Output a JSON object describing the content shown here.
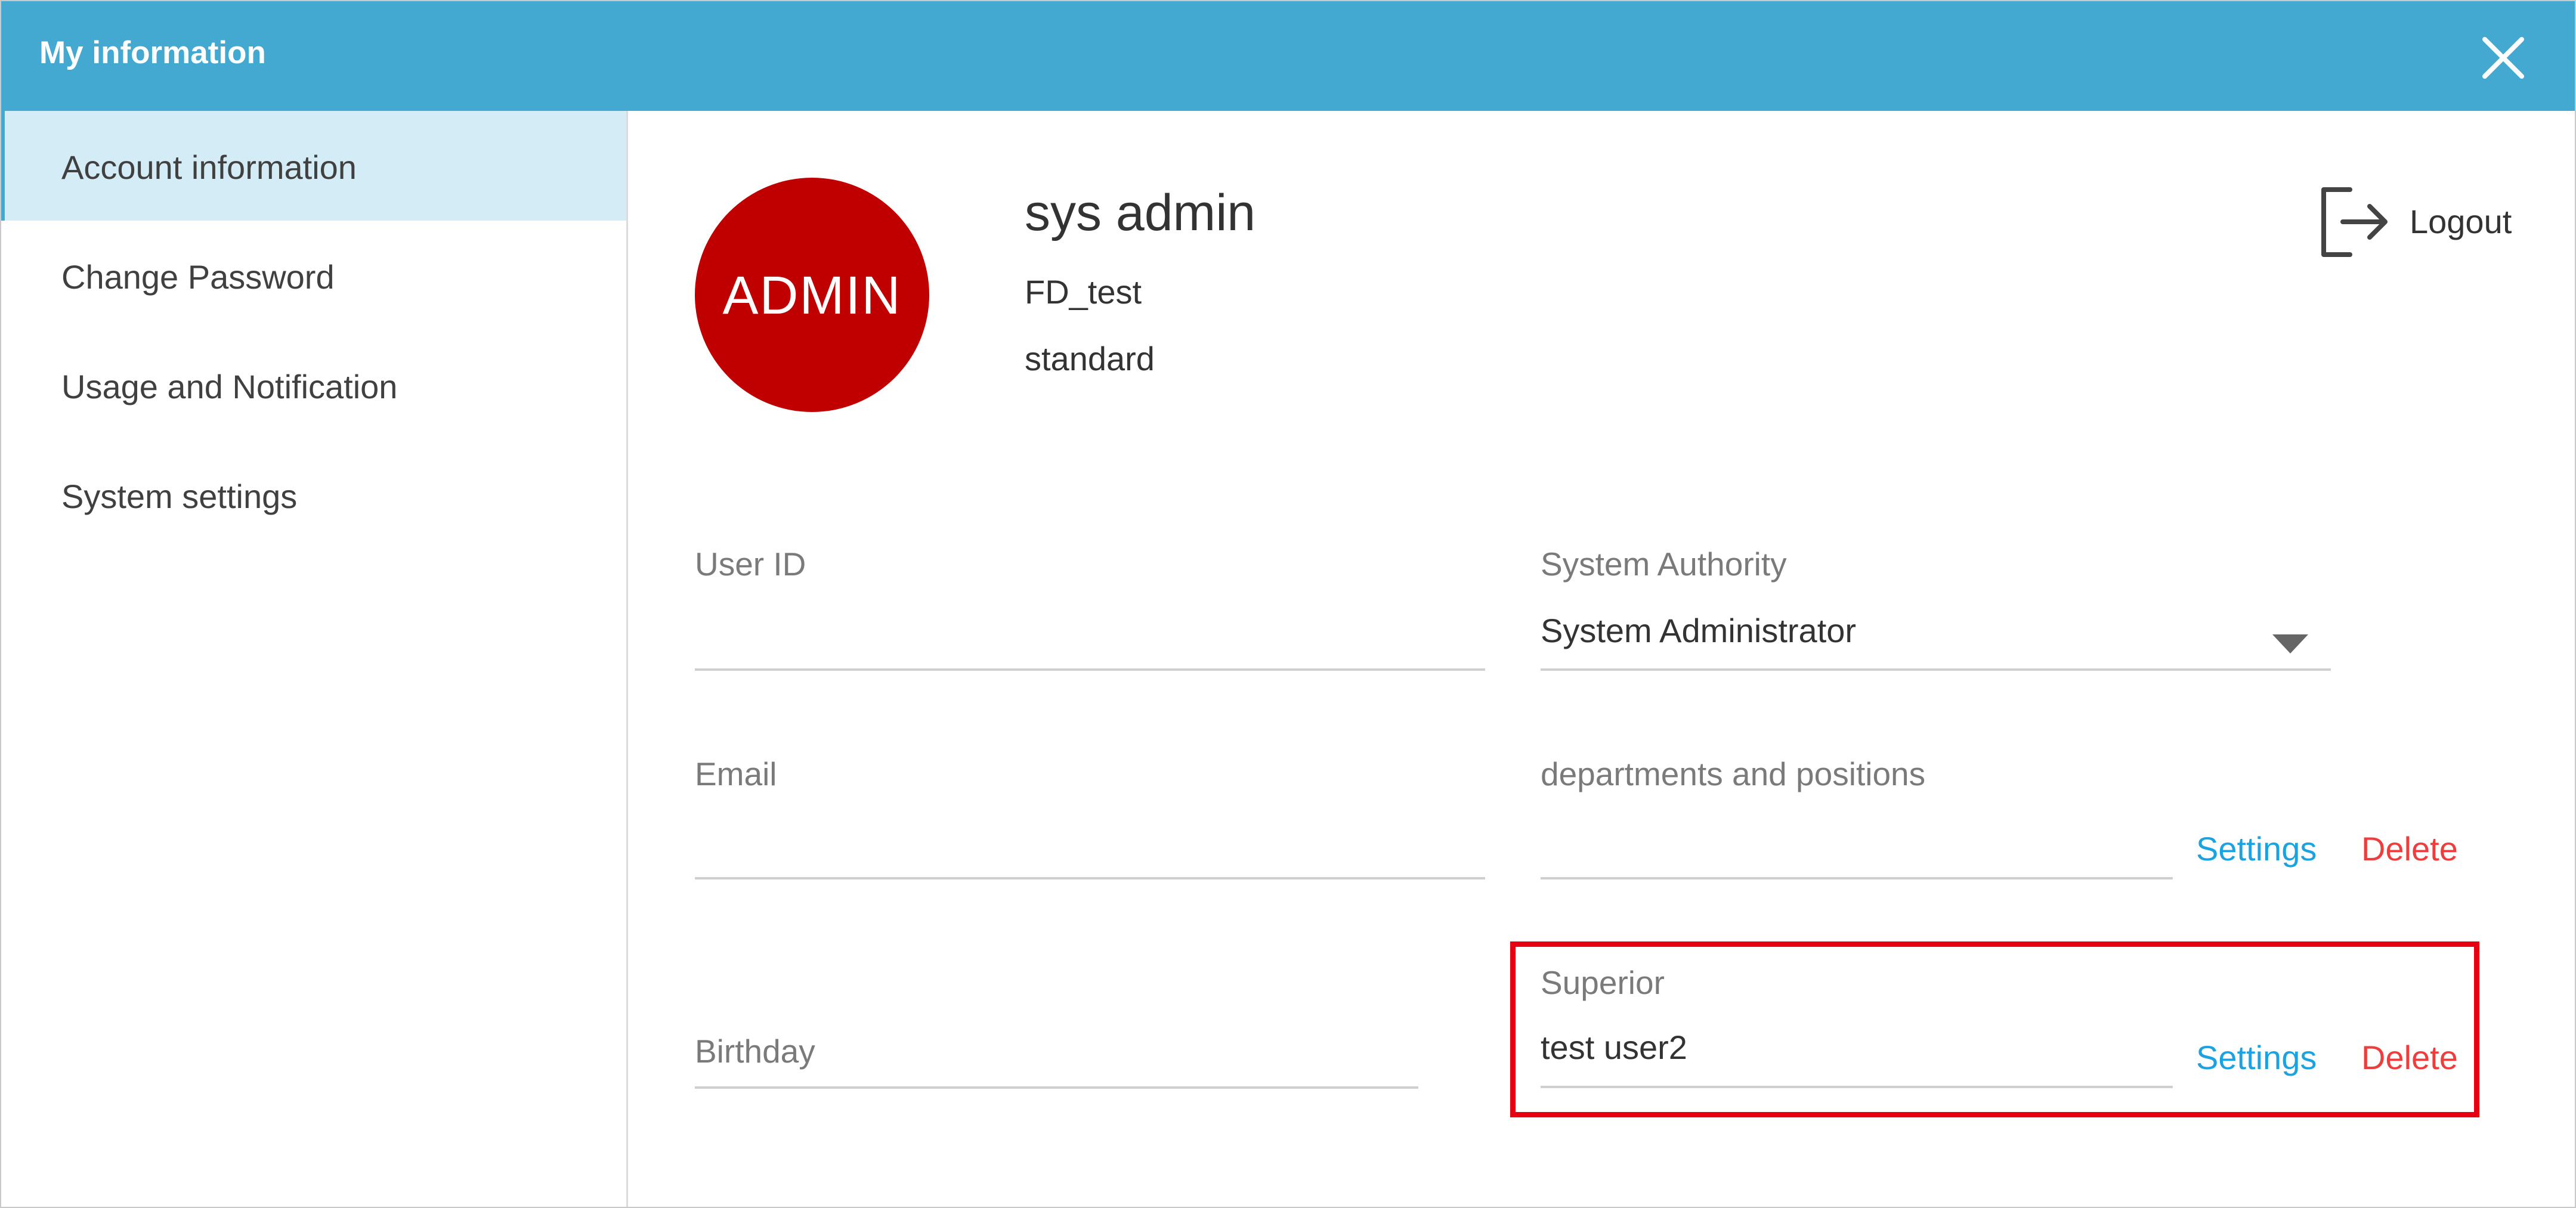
{
  "window": {
    "title": "My information"
  },
  "sidebar": {
    "items": [
      {
        "label": "Account information",
        "active": true
      },
      {
        "label": "Change Password",
        "active": false
      },
      {
        "label": "Usage and Notification",
        "active": false
      },
      {
        "label": "System settings",
        "active": false
      }
    ]
  },
  "profile": {
    "avatar_text": "ADMIN",
    "avatar_color": "#c00000",
    "name": "sys admin",
    "organization": "FD_test",
    "plan": "standard"
  },
  "actions": {
    "logout_label": "Logout"
  },
  "form": {
    "user_id": {
      "label": "User ID",
      "value": ""
    },
    "system_authority": {
      "label": "System Authority",
      "value": "System Administrator"
    },
    "email": {
      "label": "Email",
      "value": ""
    },
    "departments": {
      "label": "departments and positions",
      "value": "",
      "settings_label": "Settings",
      "delete_label": "Delete"
    },
    "birthday": {
      "label": "Birthday",
      "value": ""
    },
    "superior": {
      "label": "Superior",
      "value": "test user2",
      "settings_label": "Settings",
      "delete_label": "Delete"
    }
  },
  "colors": {
    "header": "#43a9d1",
    "sidebar_active": "#d4ecf5",
    "link": "#1aa3e0",
    "delete": "#ef3d3d",
    "highlight": "#e60012"
  },
  "icons": {
    "close": "close-icon",
    "logout": "logout-icon",
    "dropdown": "chevron-down-icon"
  }
}
